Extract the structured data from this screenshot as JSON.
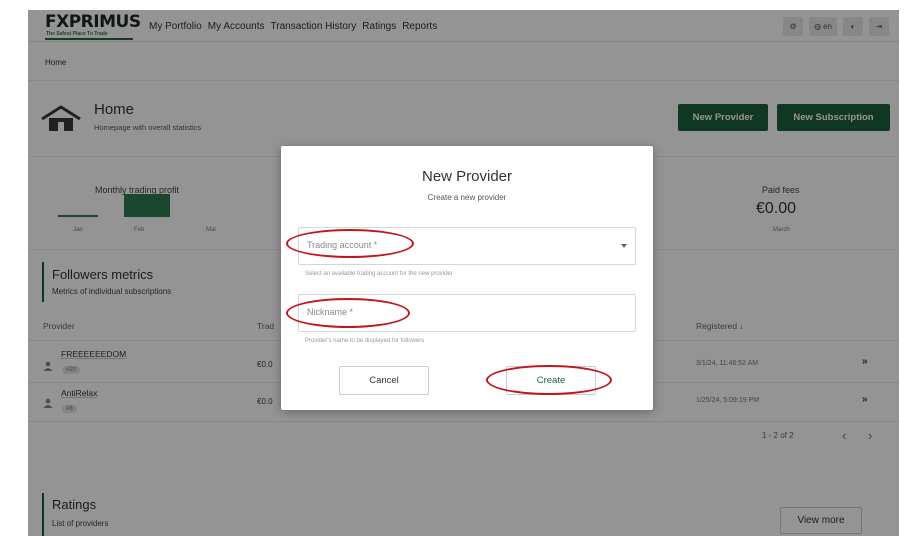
{
  "nav": {
    "logo": "FXPRIMUS",
    "logo_tagline": "The Safest Place To Trade",
    "items": [
      "My Portfolio",
      "My Accounts",
      "Transaction History",
      "Ratings",
      "Reports"
    ],
    "lang": "en"
  },
  "breadcrumb": "Home",
  "header": {
    "title": "Home",
    "subtitle": "Homepage with overall statistics",
    "new_provider_button": "New Provider",
    "new_subscription_button": "New Subscription"
  },
  "stats": {
    "monthly_profit_title": "Monthly trading profit",
    "months": [
      "Jan",
      "Feb",
      "Mar"
    ],
    "paid_fees_title": "Paid fees",
    "paid_fees_value": "€0.00",
    "paid_fees_period": "March"
  },
  "followers": {
    "title": "Followers metrics",
    "subtitle": "Metrics of individual subscriptions",
    "columns": {
      "provider": "Provider",
      "trading": "Trad",
      "registered": "Registered"
    },
    "rows": [
      {
        "name": "FREEEEEEDOM",
        "badge": "#20",
        "value": "€0.0",
        "registered": "3/1/24, 11:46:52 AM"
      },
      {
        "name": "AntiRelax",
        "badge": "#8",
        "value": "€0.0",
        "registered": "1/25/24, 5:09:19 PM"
      }
    ],
    "pagination": "1 - 2 of 2"
  },
  "ratings": {
    "title": "Ratings",
    "subtitle": "List of providers",
    "view_more": "View more"
  },
  "modal": {
    "title": "New Provider",
    "subtitle": "Create a new provider",
    "trading_account_label": "Trading account *",
    "trading_account_hint": "Select an available trading account for the new provider",
    "nickname_label": "Nickname *",
    "nickname_hint": "Provider's name to be displayed for followers",
    "cancel": "Cancel",
    "create": "Create"
  },
  "colors": {
    "brand_green": "#1c5f3a",
    "annotation_red": "#c0161d"
  }
}
